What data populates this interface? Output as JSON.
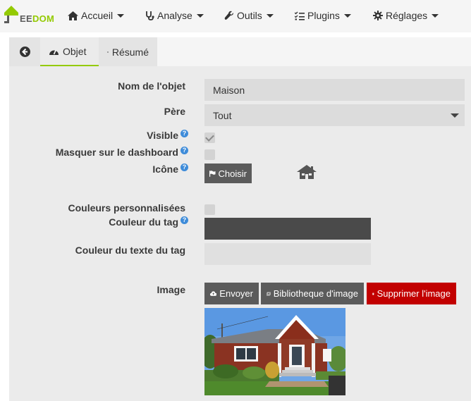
{
  "navbar": {
    "logo_text_a": "EE",
    "logo_text_b": "DOM",
    "items": [
      {
        "label": "Accueil",
        "icon": "home-icon"
      },
      {
        "label": "Analyse",
        "icon": "stethoscope-icon"
      },
      {
        "label": "Outils",
        "icon": "wrench-icon"
      },
      {
        "label": "Plugins",
        "icon": "tasks-icon"
      },
      {
        "label": "Réglages",
        "icon": "gear-icon"
      }
    ]
  },
  "tabs": {
    "back_icon": "arrow-left-circle-icon",
    "objet_label": "Objet",
    "resume_label": "Résumé"
  },
  "form": {
    "name_label": "Nom de l'objet",
    "name_value": "Maison",
    "parent_label": "Père",
    "parent_value": "Tout",
    "visible_label": "Visible",
    "visible_checked": true,
    "hide_dashboard_label": "Masquer sur le dashboard",
    "hide_dashboard_checked": false,
    "icon_label": "Icône",
    "choose_button": "Choisir",
    "selected_icon": "house-icon",
    "custom_colors_label": "Couleurs personnalisées",
    "custom_colors_checked": false,
    "tag_color_label": "Couleur du tag",
    "tag_color": "#4a4a4a",
    "tag_text_color_label": "Couleur du texte du tag",
    "tag_text_color": "#e0e0e0",
    "image_label": "Image",
    "upload_button": "Envoyer",
    "library_button": "Bibliotheque d'image",
    "delete_button": "Supprimer l'image"
  },
  "colors": {
    "brand_green": "#94ca02",
    "danger_red": "#c20000",
    "button_dark": "#5b5b5b",
    "help_blue": "#3d8bd9"
  }
}
